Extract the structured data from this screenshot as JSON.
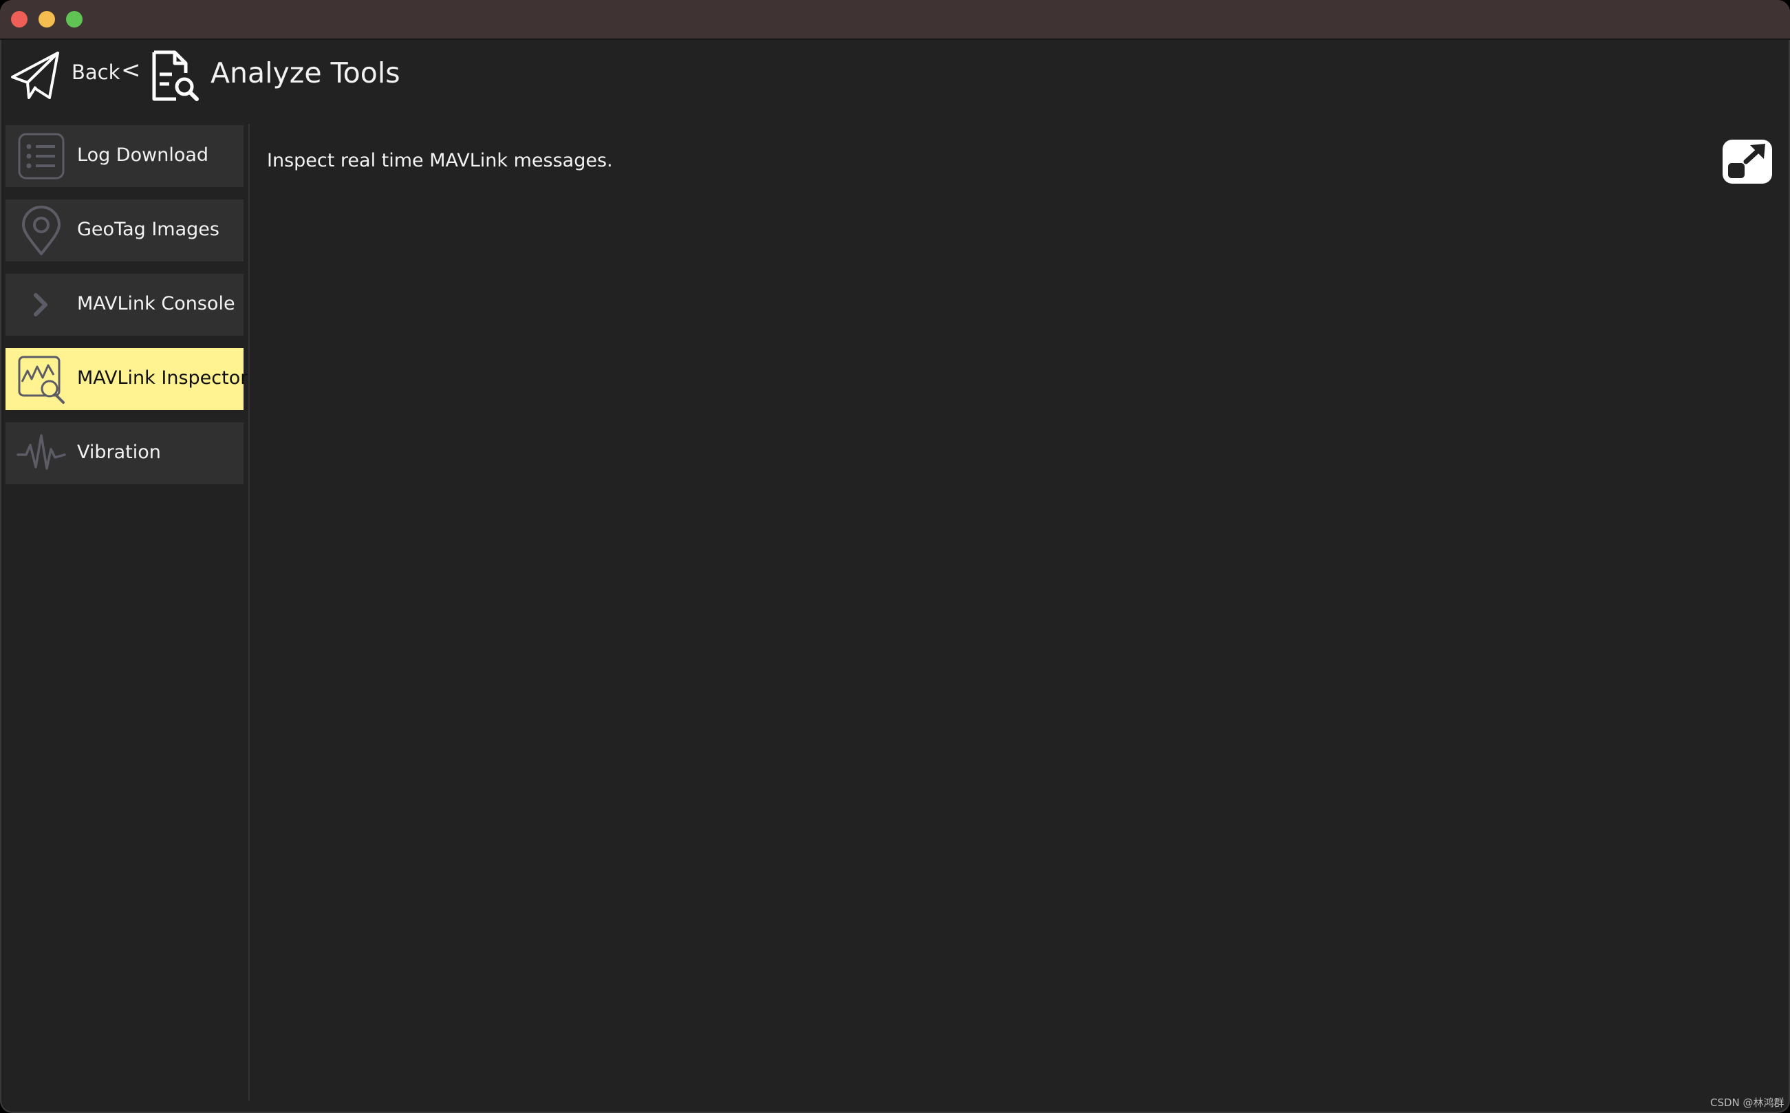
{
  "window": {
    "buttons": [
      "close",
      "minimize",
      "maximize"
    ]
  },
  "toolbar": {
    "back_label": "Back",
    "breadcrumb_separator": "<",
    "page_title": "Analyze Tools",
    "back_icon": "paper-plane-icon",
    "title_icon": "document-search-icon"
  },
  "sidebar": {
    "items": [
      {
        "label": "Log Download",
        "icon": "list-icon",
        "active": false
      },
      {
        "label": "GeoTag Images",
        "icon": "map-pin-icon",
        "active": false
      },
      {
        "label": "MAVLink Console",
        "icon": "chevron-right-icon",
        "active": false
      },
      {
        "label": "MAVLink Inspector",
        "icon": "chart-search-icon",
        "active": true
      },
      {
        "label": "Vibration",
        "icon": "waveform-icon",
        "active": false
      }
    ]
  },
  "main": {
    "description": "Inspect real time MAVLink messages.",
    "popout_icon": "popout-window-icon"
  },
  "watermark": "CSDN @林鸿群",
  "colors": {
    "background": "#222222",
    "titlebar": "#3f3433",
    "nav_item": "#303030",
    "nav_active": "#fff291",
    "text": "#f2f2f2"
  }
}
